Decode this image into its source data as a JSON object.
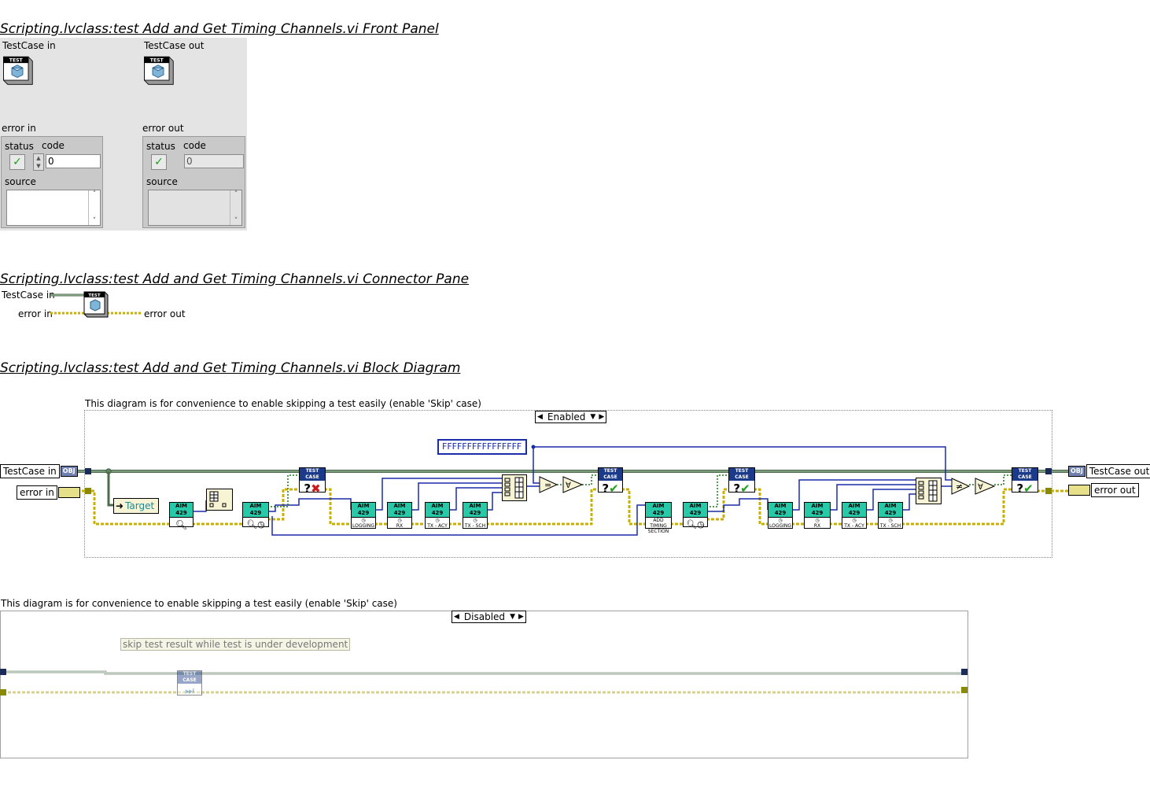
{
  "front_panel": {
    "title": "Scripting.lvclass:test Add and Get Timing Channels.vi Front Panel",
    "testcase_in_label": "TestCase in",
    "testcase_out_label": "TestCase out",
    "error_in": {
      "label": "error in",
      "status_label": "status",
      "code_label": "code",
      "code_value": "0",
      "source_label": "source"
    },
    "error_out": {
      "label": "error out",
      "status_label": "status",
      "code_label": "code",
      "code_value": "0",
      "source_label": "source"
    }
  },
  "connector_pane": {
    "title": "Scripting.lvclass:test Add and Get Timing Channels.vi Connector Pane",
    "testcase_in": "TestCase in",
    "error_in": "error in",
    "error_out": "error out"
  },
  "block_diagram": {
    "title": "Scripting.lvclass:test Add and Get Timing Channels.vi Block Diagram",
    "comment_enabled": "This diagram is for convenience to enable skipping a test easily (enable 'Skip' case)",
    "enabled_case": "Enabled",
    "hex_constant": "FFFFFFFFFFFFFFFF",
    "testcase_in": "TestCase in",
    "error_in": "error in",
    "testcase_out": "TestCase out",
    "error_out": "error out",
    "target_label": "Target",
    "aim_header": "AIM 429",
    "node_logging": "LOGGING",
    "node_rx": "RX",
    "node_tx_acy": "TX - ACY",
    "node_tx_sch": "TX - SCH",
    "node_add_timing": "ADD TIMING SECTION",
    "test_case_header": "TEST CASE",
    "comment_disabled": "This diagram is for convenience to enable skipping a test easily (enable 'Skip' case)",
    "disabled_case": "Disabled",
    "skip_comment": "skip test result while test is under development"
  },
  "colors": {
    "class_wire": "#4d6b4d",
    "error_wire": "#c8b000",
    "numeric_wire": "#1b2ca8",
    "aim_header": "#27c9a9",
    "testcase_header": "#1b3a8a"
  }
}
